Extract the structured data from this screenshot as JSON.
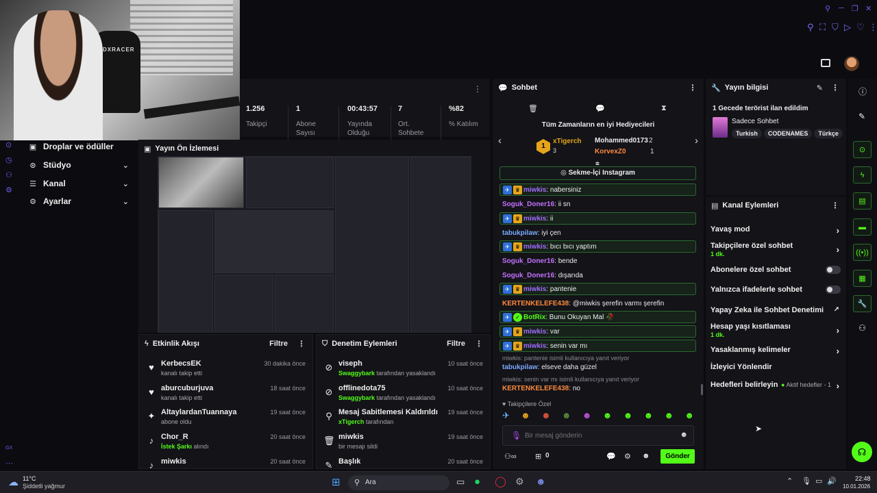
{
  "stats": [
    {
      "value": "1.256",
      "label": "Takipçi"
    },
    {
      "value": "1",
      "label": "Abone Sayısı"
    },
    {
      "value": "00:43:57",
      "label": "Yayında Olduğu"
    },
    {
      "value": "7",
      "label": "Ort. Sohbete"
    },
    {
      "value": "%82",
      "label": "% Katılım"
    }
  ],
  "menu": {
    "drops": "Droplar ve ödüller",
    "studio": "Stüdyo",
    "channel": "Kanal",
    "settings": "Ayarlar"
  },
  "preview": {
    "title": "Yayın Ön İzlemesi"
  },
  "activity": {
    "title": "Etkinlik Akışı",
    "filter": "Filtre",
    "items": [
      {
        "name": "KerbecsEK",
        "sub": "kanalı takip etti",
        "time": "30 dakika önce",
        "icon": "heart-icon"
      },
      {
        "name": "aburcuburjuva",
        "sub": "kanalı takip etti",
        "time": "18 saat önce",
        "icon": "heart-icon"
      },
      {
        "name": "AltaylardanTuannaya",
        "sub": "abone oldu",
        "time": "19 saat önce",
        "icon": "star-icon"
      },
      {
        "name": "Chor_R",
        "sub_hl": "İstek Şarkı",
        "sub": "alındı",
        "time": "20 saat önce",
        "icon": "music-icon"
      },
      {
        "name": "miwkis",
        "sub": "",
        "time": "20 saat önce",
        "icon": "music-icon"
      }
    ]
  },
  "moderation": {
    "title": "Denetim Eylemleri",
    "filter": "Filtre",
    "items": [
      {
        "name": "viseph",
        "sub_hl": "Swaggybark",
        "sub": "tarafından yasaklandı",
        "time": "10 saat önce"
      },
      {
        "name": "offlinedota75",
        "sub_hl": "Swaggybark",
        "sub": "tarafından yasaklandı",
        "time": "10 saat önce"
      },
      {
        "name": "Mesaj Sabitlemesi Kaldırıldı",
        "sub_hl": "xTigerch",
        "sub": "tarafından",
        "time": "19 saat önce"
      },
      {
        "name": "miwkis",
        "sub_hl": "",
        "sub": "bir mesajı sildi",
        "time": "19 saat önce"
      },
      {
        "name": "Başlık",
        "sub_hl": "",
        "sub": "",
        "time": "20 saat önce"
      }
    ]
  },
  "chat": {
    "title": "Sohbet",
    "gifters_title": "Tüm Zamanların en iyi Hediyecileri",
    "gifter1_name": "xTigerch",
    "gifter1_count": "3",
    "gifter2_name": "Mohammed0173",
    "gifter2_count": "2",
    "gifter3_name": "KorvexZ0",
    "gifter3_count": "1",
    "pinned": "Sekme-İçi Instagram",
    "messages": [
      {
        "user": "miwkis",
        "text": "nabersiniz",
        "hl": true,
        "color": "purple"
      },
      {
        "user": "Soguk_Doner16",
        "text": "ii sn",
        "hl": false,
        "color": "pink"
      },
      {
        "user": "miwkis",
        "text": "ii",
        "hl": true,
        "color": "purple"
      },
      {
        "user": "tabukpilaw",
        "text": "iyi çen",
        "hl": false,
        "color": "blue"
      },
      {
        "user": "miwkis",
        "text": "bıcı bıcı yaptım",
        "hl": true,
        "color": "purple"
      },
      {
        "user": "Soguk_Doner16",
        "text": "bende",
        "hl": false,
        "color": "pink"
      },
      {
        "user": "Soguk_Doner16",
        "text": "dışarıda",
        "hl": false,
        "color": "pink"
      },
      {
        "user": "miwkis",
        "text": "pantenie",
        "hl": true,
        "color": "purple"
      },
      {
        "user": "KERTENKELEFE438",
        "text": "@miwkis şerefin varmı şerefin",
        "hl": false,
        "color": "orange"
      },
      {
        "user": "BotRix",
        "text": "Bunu Okuyan Mal 🥀",
        "hl": true,
        "color": "green"
      },
      {
        "user": "miwkis",
        "text": "var",
        "hl": true,
        "color": "purple"
      },
      {
        "user": "miwkis",
        "text": "senin var mı",
        "hl": true,
        "color": "purple"
      }
    ],
    "reply1": "miwkis: pantenie isimli kullanıcıya yanıt veriyor",
    "msg_tabuk2_user": "tabukpilaw",
    "msg_tabuk2_text": "elseve daha güzel",
    "reply2": "miwkis: senin var mı isimli kullanıcıya yanıt veriyor",
    "msg_kerten2_user": "KERTENKELEFE438",
    "msg_kerten2_text": "no",
    "followers_only": "Takipçilere Özel",
    "input_placeholder": "Bir mesaj gönderin",
    "count": "0",
    "send": "Gönder"
  },
  "info": {
    "title": "Yayın bilgisi",
    "stream_title": "1 Gecede terörist ilan edildim",
    "category": "Sadece Sohbet",
    "tags": [
      "Turkish",
      "CODENAMES",
      "Türkçe"
    ]
  },
  "actions": {
    "title": "Kanal Eylemleri",
    "slow": "Yavaş mod",
    "followers": "Takipçilere özel sohbet",
    "followers_sub": "1 dk.",
    "subs": "Abonelere özel sohbet",
    "emotes": "Yalnızca ifadelerle sohbet",
    "ai": "Yapay Zeka ile Sohbet Denetimi",
    "age": "Hesap yaşı kısıtlaması",
    "age_sub": "1 dk.",
    "banned": "Yasaklanmış kelimeler",
    "redirect": "İzleyici Yönlendir",
    "goals": "Hedefleri belirleyin",
    "goals_status": "Aktif hedefler - 1"
  },
  "taskbar": {
    "temp": "11°C",
    "weather": "Şiddetli yağmur",
    "search": "Ara",
    "time": "22:48",
    "date": "10.01.2026"
  },
  "colors": {
    "accent": "#53fc18",
    "purple": "#a36cff",
    "bg": "#131318"
  }
}
